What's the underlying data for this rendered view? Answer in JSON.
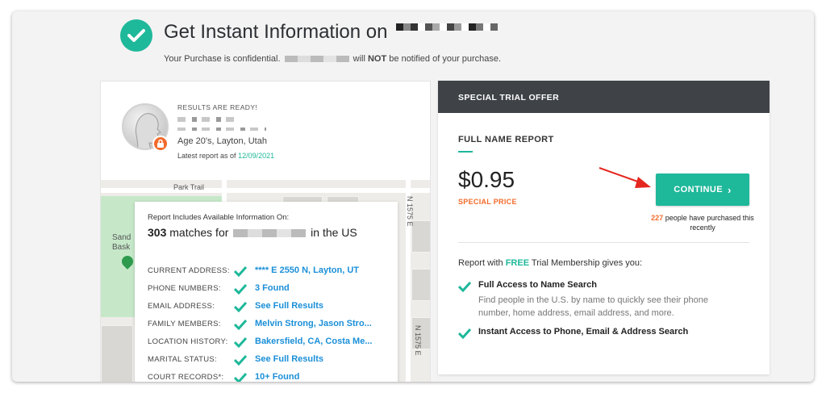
{
  "header": {
    "title": "Get Instant Information on",
    "subtitle_before": "Your Purchase is confidential.",
    "subtitle_will": "will",
    "subtitle_not": "NOT",
    "subtitle_after": "be notified of your purchase.",
    "check_icon": "check-circle-icon"
  },
  "results": {
    "status": "RESULTS ARE READY!",
    "age_location": "Age 20's, Layton, Utah",
    "latest_label": "Latest report as of",
    "latest_date": "12/09/2021"
  },
  "map": {
    "labels": [
      "Park Trail",
      "N 1575 E",
      "N 1575 E",
      "Sand",
      "Bask"
    ]
  },
  "report": {
    "heading": "Report Includes Available Information On:",
    "matches_count": "303",
    "matches_text": "matches for",
    "matches_suffix": "in the US",
    "rows": [
      {
        "label": "CURRENT ADDRESS:",
        "value": "**** E 2550 N, Layton, UT"
      },
      {
        "label": "PHONE NUMBERS:",
        "value": "3 Found"
      },
      {
        "label": "EMAIL ADDRESS:",
        "value": "See Full Results"
      },
      {
        "label": "FAMILY MEMBERS:",
        "value": "Melvin Strong, Jason Stro..."
      },
      {
        "label": "LOCATION HISTORY:",
        "value": "Bakersfield, CA, Costa Me..."
      },
      {
        "label": "MARITAL STATUS:",
        "value": "See Full Results"
      },
      {
        "label": "COURT RECORDS*:",
        "value": "10+ Found"
      }
    ]
  },
  "offer": {
    "bar_title": "SPECIAL TRIAL OFFER",
    "product": "FULL NAME REPORT",
    "price": "$0.95",
    "price_note": "SPECIAL PRICE",
    "continue_label": "CONTINUE",
    "continue_chevron": "›",
    "purchased_count": "227",
    "purchased_text": "people have purchased this recently",
    "trial_before": "Report with",
    "trial_free": "FREE",
    "trial_after": "Trial Membership gives you:",
    "features": [
      {
        "title": "Full Access to Name Search",
        "desc": "Find people in the U.S. by name to quickly see their phone number, home address, email address, and more."
      },
      {
        "title": "Instant Access to Phone, Email & Address Search",
        "desc": ""
      }
    ]
  },
  "colors": {
    "accent": "#1eb89a",
    "link": "#1a8fd8",
    "warning": "#f26a2a",
    "dark_bar": "#3f4246",
    "annotation_arrow": "#e5261f"
  }
}
